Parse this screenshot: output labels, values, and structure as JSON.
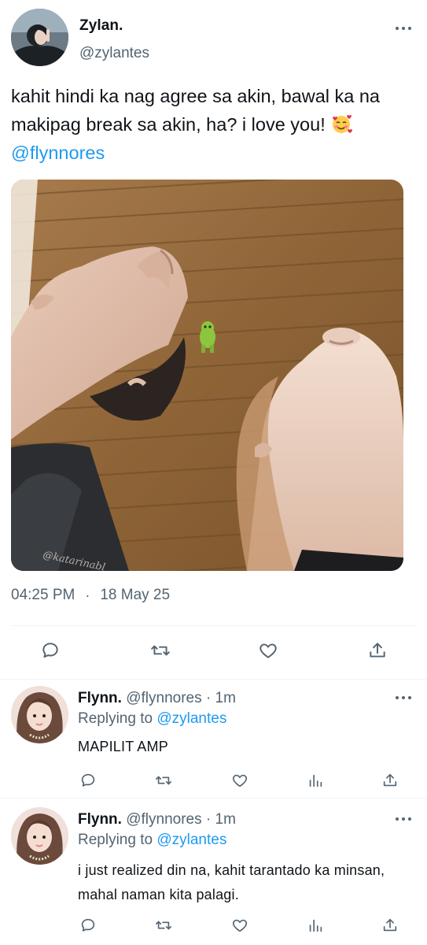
{
  "main_tweet": {
    "author_name": "Zylan.",
    "author_handle": "@zylantes",
    "text": "kahit hindi ka nag agree sa akin, bawal ka na makipag break sa akin, ha? i love you!",
    "mention": "@flynnores",
    "emoji_icon": "smiling-face-with-hearts-icon",
    "image_watermark": "@katarinabl",
    "time": "04:25 PM",
    "separator": "·",
    "date": "18 May 25",
    "actions": [
      "reply-icon",
      "retweet-icon",
      "like-icon",
      "share-icon"
    ]
  },
  "replies": [
    {
      "author_name": "Flynn.",
      "author_handle": "@flynnores",
      "separator": "·",
      "time_ago": "1m",
      "replying_label": "Replying to",
      "replying_to": "@zylantes",
      "text": "MAPILIT AMP"
    },
    {
      "author_name": "Flynn.",
      "author_handle": "@flynnores",
      "separator": "·",
      "time_ago": "1m",
      "replying_label": "Replying to",
      "replying_to": "@zylantes",
      "text": "i just realized din na, kahit tarantado ka minsan, mahal naman kita palagi."
    }
  ],
  "colors": {
    "accent": "#1d9bf0",
    "secondary_text": "#536471",
    "divider": "#eff3f4"
  }
}
